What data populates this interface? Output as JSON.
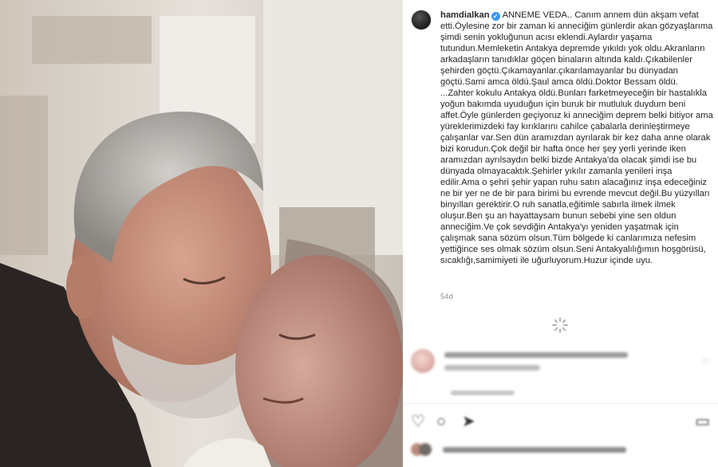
{
  "post": {
    "username": "hamdialkan",
    "caption": "ANNEME VEDA.. Canım annem dün akşam vefat etti.Öylesine zor bir zaman ki anneciğim günlerdir akan gözyaşlarıma şimdi senin yokluğunun acısı eklendi.Aylardır yaşama tutundun.Memleketin Antakya depremde yıkıldı yok oldu.Akranların arkadaşların tanıdıklar göçen binaların altında kaldı.Çıkabilenler şehirden göçtü.Çıkamayanlar.çıkarılamayanlar bu dünyadan göçtü.Sami amca öldü.Şaul amca öldü.Doktor Bessam öldü. ...Zahter kokulu Antakya öldü.Bunları farketmeyeceğin bir hastalıkla yoğun bakımda uyuduğun için buruk bir mutluluk duydum beni affet.Öyle günlerden geçiyoruz ki anneciğim deprem belki bitiyor ama yüreklerimizdeki fay kırıklarını cahilce çabalarla derinleştirmeye çalışanlar var.Sen dün aramızdan ayrılarak bir kez daha anne olarak bizi korudun.Çok değil bir hafta önce her şey yerli yerinde iken aramızdan ayrılsaydın belki bizde Antakya'da olacak şimdi ise bu dünyada olmayacaktık.Şehirler yıkılır zamanla yenileri inşa edilir.Ama o şehri şehir yapan ruhu satın alacağınız inşa edeceğiniz ne bir yer ne de bir para birimi bu evrende mevcut değil.Bu yüzyılları binyılları gerektirir.O ruh sanatla,eğitimle sabırla ilmek ilmek oluşur.Ben şu an hayattaysam bunun sebebi yine sen oldun anneciğim.Ve çok sevdiğin Antakya'yı yeniden yaşatmak için çalışmak sana sözüm olsun.Tüm bölgede ki canlarımıza nefesim yettiğince ses olmak sözüm olsun.Seni Antakyalılığımın hoşgörüsü, sıcaklığı,samimiyeti ile uğurluyorum.Huzur içinde uyu.",
    "age": "54d",
    "verified_color": "#3897f0"
  },
  "icons": {
    "verified": "verified-badge-icon",
    "loader": "loading-spinner-icon",
    "heart": "heart-icon",
    "comment": "comment-icon",
    "share": "share-icon",
    "save": "bookmark-icon"
  }
}
